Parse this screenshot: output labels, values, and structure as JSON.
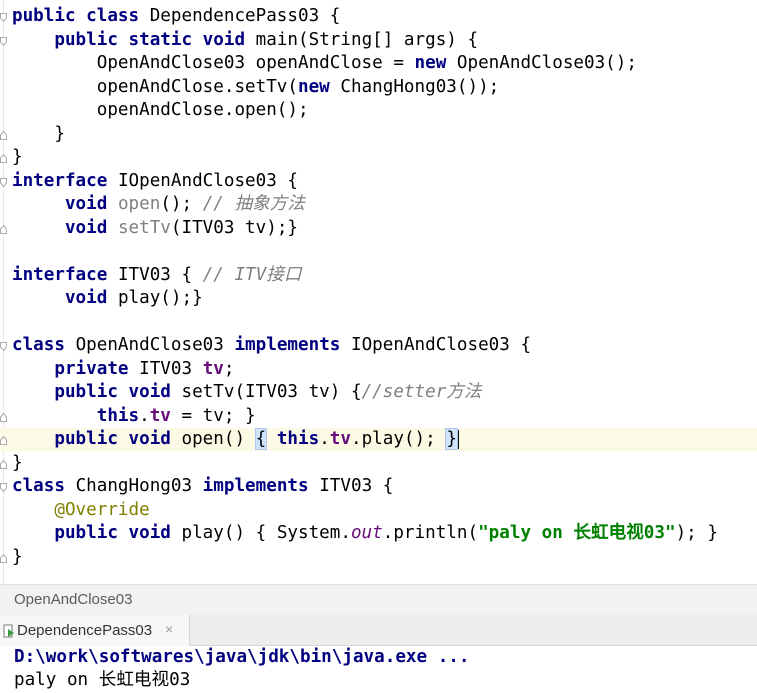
{
  "editor": {
    "lines": [
      [
        {
          "t": "public class ",
          "c": "kw"
        },
        {
          "t": "DependencePass03 {"
        }
      ],
      [
        {
          "t": "    "
        },
        {
          "t": "public static void ",
          "c": "kw"
        },
        {
          "t": "main(String[] args) {"
        }
      ],
      [
        {
          "t": "        OpenAndClose03 openAndClose = "
        },
        {
          "t": "new ",
          "c": "kw"
        },
        {
          "t": "OpenAndClose03();"
        }
      ],
      [
        {
          "t": "        openAndClose.setTv("
        },
        {
          "t": "new ",
          "c": "kw"
        },
        {
          "t": "ChangHong03());"
        }
      ],
      [
        {
          "t": "        openAndClose.open();"
        }
      ],
      [
        {
          "t": "    }"
        }
      ],
      [
        {
          "t": "}"
        }
      ],
      [
        {
          "t": "interface ",
          "c": "kw"
        },
        {
          "t": "IOpenAndClose03 {"
        }
      ],
      [
        {
          "t": "     "
        },
        {
          "t": "void ",
          "c": "kw"
        },
        {
          "t": "open",
          "c": "unused"
        },
        {
          "t": "(); "
        },
        {
          "t": "// 抽象方法",
          "c": "cmt"
        }
      ],
      [
        {
          "t": "     "
        },
        {
          "t": "void ",
          "c": "kw"
        },
        {
          "t": "setTv",
          "c": "unused"
        },
        {
          "t": "(ITV03 tv);}"
        }
      ],
      [
        {
          "t": ""
        }
      ],
      [
        {
          "t": "interface ",
          "c": "kw"
        },
        {
          "t": "ITV03 { "
        },
        {
          "t": "// ITV接口",
          "c": "cmt"
        }
      ],
      [
        {
          "t": "     "
        },
        {
          "t": "void ",
          "c": "kw"
        },
        {
          "t": "play();}"
        }
      ],
      [
        {
          "t": ""
        }
      ],
      [
        {
          "t": "class ",
          "c": "kw"
        },
        {
          "t": "OpenAndClose03 "
        },
        {
          "t": "implements ",
          "c": "kw"
        },
        {
          "t": "IOpenAndClose03 {"
        }
      ],
      [
        {
          "t": "    "
        },
        {
          "t": "private ",
          "c": "kw"
        },
        {
          "t": "ITV03 "
        },
        {
          "t": "tv",
          "c": "fld"
        },
        {
          "t": ";"
        }
      ],
      [
        {
          "t": "    "
        },
        {
          "t": "public void ",
          "c": "kw"
        },
        {
          "t": "setTv(ITV03 tv) {"
        },
        {
          "t": "//setter方法",
          "c": "cmt"
        }
      ],
      [
        {
          "t": "        "
        },
        {
          "t": "this",
          "c": "kw"
        },
        {
          "t": "."
        },
        {
          "t": "tv",
          "c": "fld"
        },
        {
          "t": " = tv; }"
        }
      ],
      [
        {
          "t": "    "
        },
        {
          "t": "public void ",
          "c": "kw"
        },
        {
          "t": "open() "
        },
        {
          "t": "{",
          "c": "brace-hl"
        },
        {
          "t": " "
        },
        {
          "t": "this",
          "c": "kw"
        },
        {
          "t": "."
        },
        {
          "t": "tv",
          "c": "fld"
        },
        {
          "t": ".play(); "
        },
        {
          "t": "}",
          "c": "brace-hl"
        }
      ],
      [
        {
          "t": "}"
        }
      ],
      [
        {
          "t": "class ",
          "c": "kw"
        },
        {
          "t": "ChangHong03 "
        },
        {
          "t": "implements ",
          "c": "kw"
        },
        {
          "t": "ITV03 {"
        }
      ],
      [
        {
          "t": "    "
        },
        {
          "t": "@Override",
          "c": "ann"
        }
      ],
      [
        {
          "t": "    "
        },
        {
          "t": "public void ",
          "c": "kw"
        },
        {
          "t": "play() { System."
        },
        {
          "t": "out",
          "c": "static-call"
        },
        {
          "t": ".println("
        },
        {
          "t": "\"paly on 长虹电视03\"",
          "c": "str"
        },
        {
          "t": "); }"
        }
      ],
      [
        {
          "t": "}"
        }
      ]
    ],
    "current_line_index": 18
  },
  "breadcrumb": "OpenAndClose03",
  "run_tab": {
    "label": "DependencePass03",
    "close": "×"
  },
  "console": {
    "command": "D:\\work\\softwares\\java\\jdk\\bin\\java.exe ...",
    "output": "paly on 长虹电视03"
  },
  "colors": {
    "keyword": "#000080",
    "field": "#660e7a",
    "string": "#008000",
    "comment": "#808080",
    "annotation": "#808000",
    "current_line": "#fcfae5"
  }
}
